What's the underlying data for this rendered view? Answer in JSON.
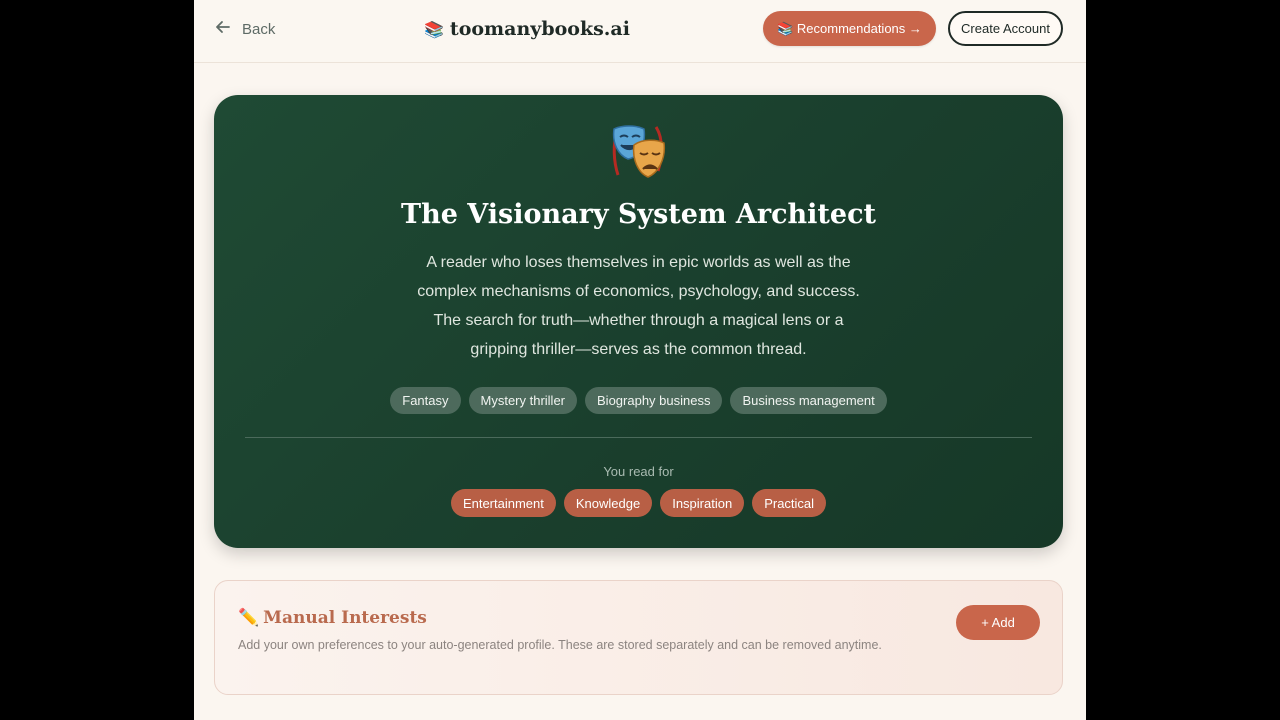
{
  "header": {
    "back_label": "Back",
    "brand_icon": "📚",
    "brand_name": "toomanybooks.ai",
    "recommendations_label": "📚 Recommendations →",
    "create_account_label": "Create Account"
  },
  "profile": {
    "emoji": "🎭",
    "title": "The Visionary System Architect",
    "description": "A reader who loses themselves in epic worlds as well as the complex mechanisms of economics, psychology, and success. The search for truth—whether through a magical lens or a gripping thriller—serves as the common thread.",
    "genres": [
      "Fantasy",
      "Mystery thriller",
      "Biography business",
      "Business management"
    ],
    "read_for_label": "You read for",
    "read_for": [
      "Entertainment",
      "Knowledge",
      "Inspiration",
      "Practical"
    ]
  },
  "manual_interests": {
    "icon": "✏️",
    "title": "Manual Interests",
    "description": "Add your own preferences to your auto-generated profile. These are stored separately and can be removed anytime.",
    "add_label": "+ Add"
  },
  "colors": {
    "accent": "#c9664b",
    "hero_green": "#1f4a34",
    "background": "#fbf6f0"
  }
}
